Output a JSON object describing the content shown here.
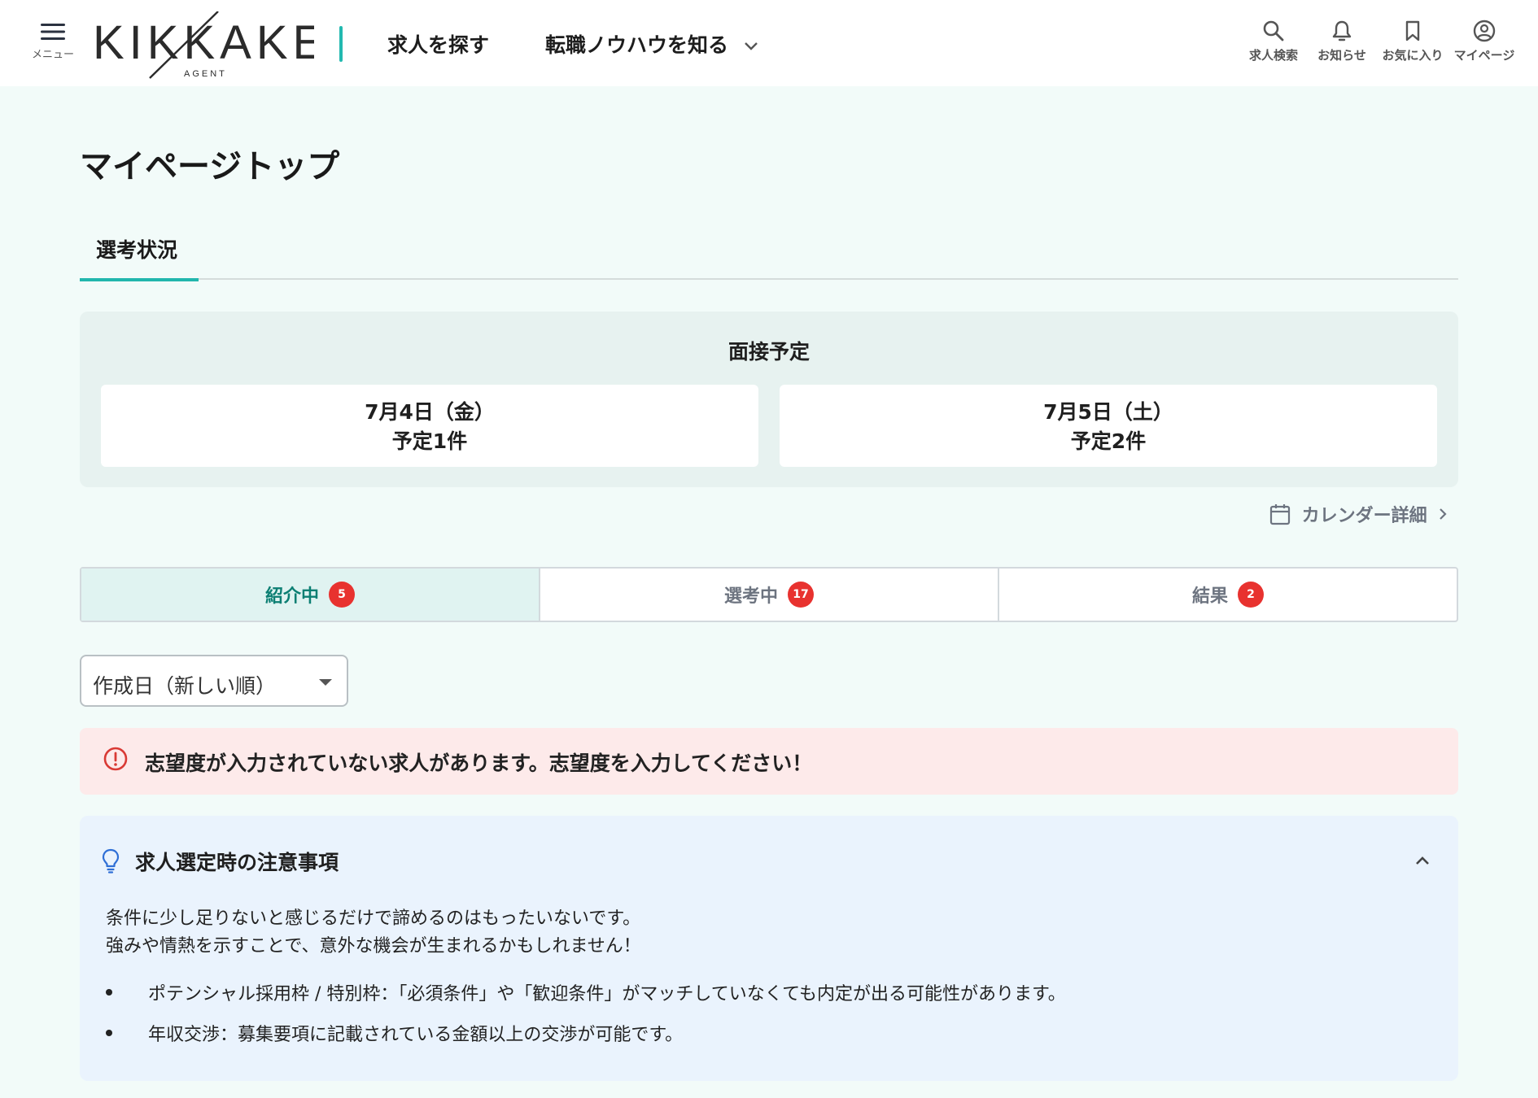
{
  "header": {
    "menu_label": "メニュー",
    "logo": {
      "text": "KIKKAKE",
      "sub": "AGENT"
    },
    "nav": [
      {
        "label": "求人を探す"
      },
      {
        "label": "転職ノウハウを知る"
      }
    ],
    "icons": [
      {
        "label": "求人検索",
        "icon": "search-icon"
      },
      {
        "label": "お知らせ",
        "icon": "bell-icon"
      },
      {
        "label": "お気に入り",
        "icon": "bookmark-icon"
      },
      {
        "label": "マイページ",
        "icon": "user-circle-icon"
      }
    ]
  },
  "page": {
    "title": "マイページトップ"
  },
  "tabs": [
    {
      "label": "選考状況",
      "active": true
    }
  ],
  "interview": {
    "title": "面接予定",
    "days": [
      {
        "date": "7月4日（金）",
        "count": "予定1件"
      },
      {
        "date": "7月5日（土）",
        "count": "予定2件"
      }
    ]
  },
  "calendar_link": {
    "label": "カレンダー詳細"
  },
  "segments": [
    {
      "label": "紹介中",
      "badge": "5",
      "active": true
    },
    {
      "label": "選考中",
      "badge": "17",
      "active": false
    },
    {
      "label": "結果",
      "badge": "2",
      "active": false
    }
  ],
  "sort": {
    "value": "作成日（新しい順）"
  },
  "alert": {
    "text": "志望度が入力されていない求人があります。志望度を入力してください！"
  },
  "tips": {
    "title": "求人選定時の注意事項",
    "paragraphs": [
      "条件に少し足りないと感じるだけで諦めるのはもったいないです。",
      "強みや情熱を示すことで、意外な機会が生まれるかもしれません！"
    ],
    "items": [
      "ポテンシャル採用枠 / 特別枠：「必須条件」や「歓迎条件」がマッチしていなくても内定が出る可能性があります。",
      "年収交渉：募集要項に記載されている金額以上の交渉が可能です。"
    ]
  },
  "colors": {
    "accent": "#21b6ad",
    "page_bg": "#f2fbf9",
    "badge": "#e8322f",
    "alert_bg": "#fdeaea",
    "tips_bg": "#eaf3fd"
  }
}
